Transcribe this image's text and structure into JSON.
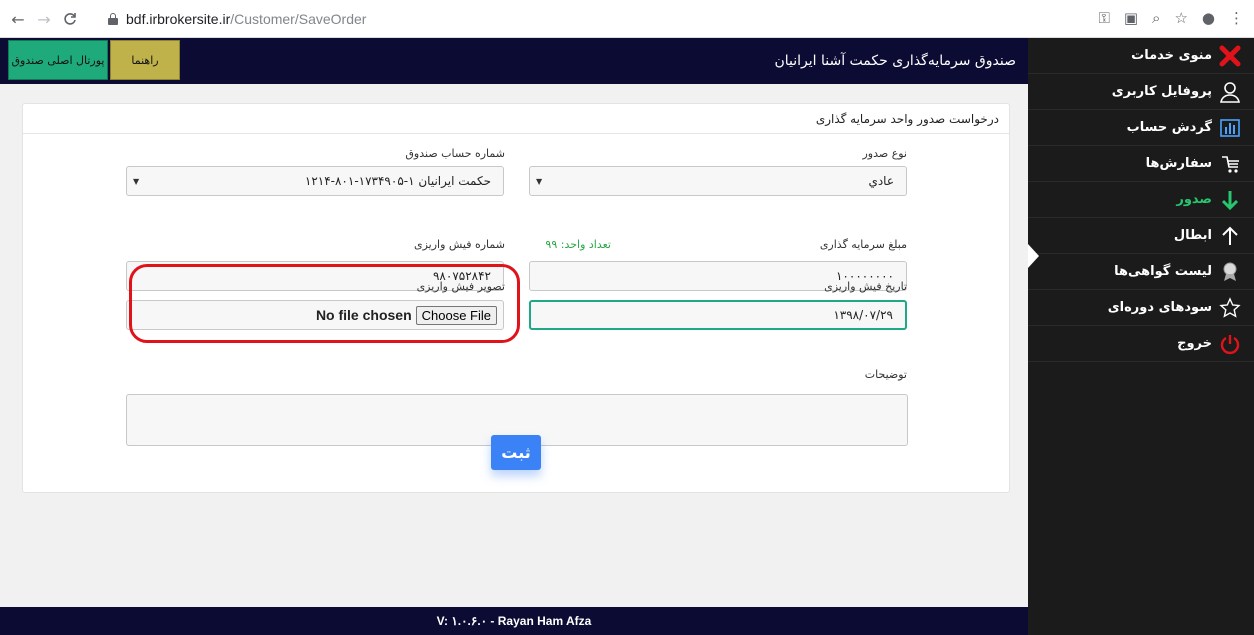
{
  "browser": {
    "url_host": "bdf.irbrokersite.ir",
    "url_path": "/Customer/SaveOrder"
  },
  "topbar": {
    "title": "صندوق سرمایه‌گذاری حکمت آشنا ایرانیان",
    "portal_button": "پورتال اصلی صندوق",
    "help_button": "راهنما"
  },
  "sidebar": {
    "items": [
      {
        "label": "منوی خدمات",
        "icon": "close-x-icon"
      },
      {
        "label": "پروفایل کاربری",
        "icon": "user-icon"
      },
      {
        "label": "گردش حساب",
        "icon": "bar-chart-icon"
      },
      {
        "label": "سفارش‌ها",
        "icon": "cart-icon"
      },
      {
        "label": "صدور",
        "icon": "arrow-down-icon"
      },
      {
        "label": "ابطال",
        "icon": "arrow-up-icon"
      },
      {
        "label": "لیست گواهی‌ها",
        "icon": "award-icon"
      },
      {
        "label": "سودهای دوره‌ای",
        "icon": "star-icon"
      },
      {
        "label": "خروج",
        "icon": "power-icon"
      }
    ],
    "active_index": 4
  },
  "form": {
    "header": "درخواست صدور واحد سرمایه گذاری",
    "issue_type_label": "نوع صدور",
    "issue_type_value": "عادي",
    "fund_account_label": "شماره حساب صندوق",
    "fund_account_value": "۱۲۱۴-۸۰۱-۱۷۳۴۹۰۵-۱ حکمت ایرانیان",
    "investment_amount_label": "مبلغ سرمایه گذاری",
    "investment_amount_value": "۱۰۰۰۰۰۰۰۰",
    "unit_count_note": "تعداد واحد: ۹۹",
    "receipt_number_label": "شماره فیش واریزی",
    "receipt_number_value": "۹۸۰۷۵۲۸۴۲",
    "receipt_date_label": "تاریخ فیش واریزی",
    "receipt_date_value": "۱۳۹۸/۰۷/۲۹",
    "receipt_image_label": "تصویر فیش واریزی",
    "file_button": "Choose File",
    "file_status": "No file chosen",
    "description_label": "توضیحات",
    "submit_label": "ثبت"
  },
  "footer": {
    "version": "V: ۱.۰.۶.۰ - Rayan Ham Afza"
  },
  "colors": {
    "topbar": "#0c0b33",
    "sidebar": "#1b1b1b",
    "portal_button": "#1eaa7a",
    "help_button": "#bfb24a",
    "submit": "#3b82f6",
    "highlight": "#e0121a",
    "active_menu": "#28c76f"
  }
}
